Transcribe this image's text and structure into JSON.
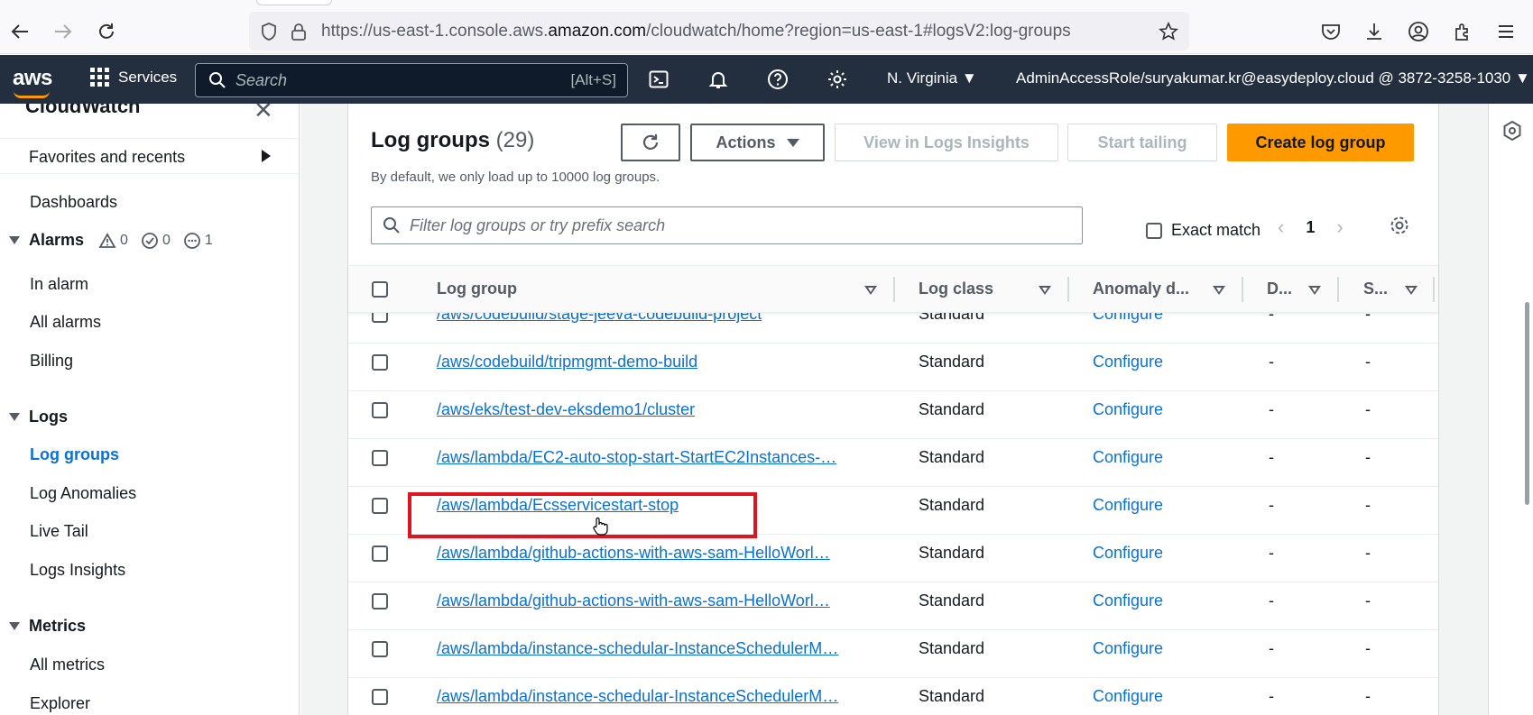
{
  "browser": {
    "url_prefix": "https://us-east-1.console.aws.",
    "url_domain": "amazon.com",
    "url_suffix": "/cloudwatch/home?region=us-east-1#logsV2:log-groups"
  },
  "header": {
    "logo": "aws",
    "services_label": "Services",
    "search_placeholder": "Search",
    "search_shortcut": "[Alt+S]",
    "region": "N. Virginia",
    "account": "AdminAccessRole/suryakumar.kr@easydeploy.cloud @ 3872-3258-1030"
  },
  "sidebar": {
    "title": "CloudWatch",
    "favorites": "Favorites and recents",
    "dashboards": "Dashboards",
    "alarms": {
      "label": "Alarms",
      "in_alarm_count": "0",
      "ok_count": "0",
      "insufficient_count": "1"
    },
    "alarm_items": [
      "In alarm",
      "All alarms",
      "Billing"
    ],
    "logs": {
      "label": "Logs",
      "items": [
        "Log groups",
        "Log Anomalies",
        "Live Tail",
        "Logs Insights"
      ]
    },
    "metrics": {
      "label": "Metrics",
      "items": [
        "All metrics",
        "Explorer"
      ]
    }
  },
  "main": {
    "title": "Log groups",
    "count": "(29)",
    "description": "By default, we only load up to 10000 log groups.",
    "actions_label": "Actions",
    "view_insights_label": "View in Logs Insights",
    "start_tailing_label": "Start tailing",
    "create_label": "Create log group",
    "filter_placeholder": "Filter log groups or try prefix search",
    "exact_match_label": "Exact match",
    "page": "1",
    "columns": {
      "log_group": "Log group",
      "log_class": "Log class",
      "anomaly": "Anomaly d...",
      "d": "D...",
      "s": "S..."
    },
    "rows": [
      {
        "name": "/aws/codebuild/stage-jeeva-codebuild-project",
        "class": "Standard",
        "anomaly": "Configure",
        "d": "-",
        "s": "-"
      },
      {
        "name": "/aws/codebuild/tripmgmt-demo-build",
        "class": "Standard",
        "anomaly": "Configure",
        "d": "-",
        "s": "-"
      },
      {
        "name": "/aws/eks/test-dev-eksdemo1/cluster",
        "class": "Standard",
        "anomaly": "Configure",
        "d": "-",
        "s": "-"
      },
      {
        "name": "/aws/lambda/EC2-auto-stop-start-StartEC2Instances-…",
        "class": "Standard",
        "anomaly": "Configure",
        "d": "-",
        "s": "-"
      },
      {
        "name": "/aws/lambda/Ecsservicestart-stop",
        "class": "Standard",
        "anomaly": "Configure",
        "d": "-",
        "s": "-"
      },
      {
        "name": "/aws/lambda/github-actions-with-aws-sam-HelloWorl…",
        "class": "Standard",
        "anomaly": "Configure",
        "d": "-",
        "s": "-"
      },
      {
        "name": "/aws/lambda/github-actions-with-aws-sam-HelloWorl…",
        "class": "Standard",
        "anomaly": "Configure",
        "d": "-",
        "s": "-"
      },
      {
        "name": "/aws/lambda/instance-schedular-InstanceSchedulerM…",
        "class": "Standard",
        "anomaly": "Configure",
        "d": "-",
        "s": "-"
      },
      {
        "name": "/aws/lambda/instance-schedular-InstanceSchedulerM…",
        "class": "Standard",
        "anomaly": "Configure",
        "d": "-",
        "s": "-"
      }
    ]
  },
  "colors": {
    "header_bg": "#232f3e",
    "accent_orange": "#ff9900",
    "link_blue": "#0972d3",
    "highlight_red": "#e0141e"
  }
}
